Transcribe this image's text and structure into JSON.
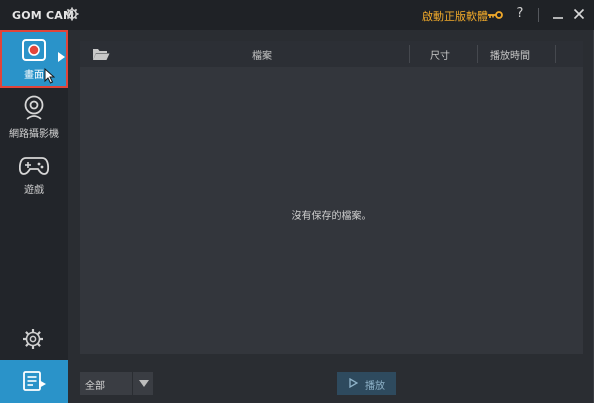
{
  "titlebar": {
    "app_name": "GOM CAM",
    "activate_label": "啟動正版軟體",
    "help_label": "?",
    "accent_color": "#f0a92a"
  },
  "sidebar": {
    "items": [
      {
        "label": "畫面",
        "icon": "screen-record-icon",
        "selected": true
      },
      {
        "label": "網路攝影機",
        "icon": "webcam-icon",
        "selected": false
      },
      {
        "label": "遊戲",
        "icon": "gamepad-icon",
        "selected": false
      }
    ],
    "settings_icon": "gear-icon",
    "list_icon": "video-list-icon",
    "accent_color": "#2a93c9"
  },
  "file_table": {
    "columns": [
      "檔案",
      "尺寸",
      "播放時間"
    ],
    "empty_message": "沒有保存的檔案。"
  },
  "bottom": {
    "filter_value": "全部",
    "play_label": "播放"
  }
}
